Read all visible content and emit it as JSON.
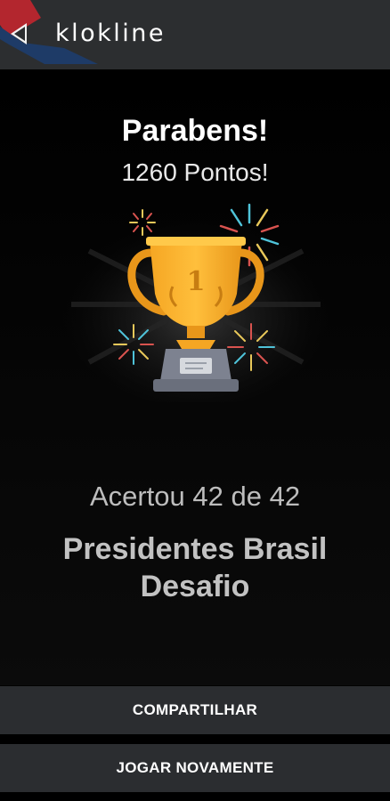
{
  "header": {
    "brand": "klokline",
    "logo_icon": "klokline-logo-icon",
    "bar_color": "#2c2e30",
    "logo_colors": [
      "#b3262e",
      "#1e3b67"
    ]
  },
  "result": {
    "title": "Parabens!",
    "points": "1260 Pontos!",
    "trophy_icon": "trophy-icon",
    "trophy_rank": "1",
    "score_line": "Acertou 42 de 42",
    "quiz_title": "Presidentes Brasil Desafio"
  },
  "actions": {
    "share_label": "COMPARTILHAR",
    "replay_label": "JOGAR NOVAMENTE"
  }
}
